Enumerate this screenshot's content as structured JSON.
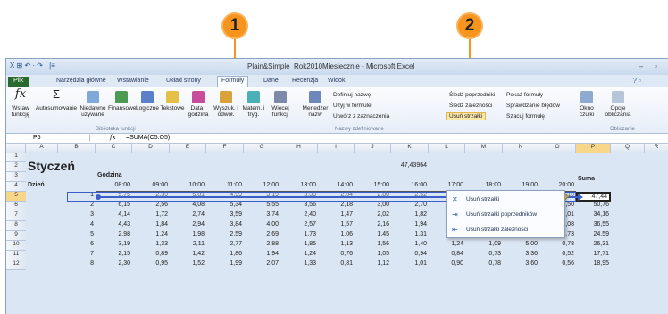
{
  "callouts": [
    "1",
    "2"
  ],
  "window": {
    "title": "Plain&Simple_Rok2010Miesiecznie - Microsoft Excel",
    "qat": "X ⊞ ↶ · ↷ · |≡"
  },
  "tabs": [
    "Plik",
    "Narzędzia główne",
    "Wstawianie",
    "Układ strony",
    "Formuły",
    "Dane",
    "Recenzja",
    "Widok"
  ],
  "ribbon": {
    "insert_function": "Wstaw funkcję",
    "autosum": "Autosumowanie",
    "recent": "Niedawno używane",
    "financial": "Finansowe",
    "logical": "Logiczne",
    "text": "Tekstowe",
    "datetime": "Data i godzina",
    "lookup": "Wyszuk. i odwoł.",
    "math": "Matem. i tryg.",
    "more": "Więcej funkcji",
    "library_group": "Biblioteka funkcji",
    "name_manager": "Menedżer nazw",
    "define_name": "Definiuj nazwę",
    "use_in_formula": "Użyj w formule",
    "create_from_selection": "Utwórz z zaznaczenia",
    "names_group": "Nazwy zdefiniowane",
    "trace_precedents": "Śledź poprzedniki",
    "trace_dependents": "Śledź zależności",
    "remove_arrows": "Usuń strzałki",
    "show_formulas": "Pokaż formuły",
    "error_checking": "Sprawdzanie błędów",
    "evaluate_formula": "Szacuj formułę",
    "watch_window": "Okno czujki",
    "calc_options": "Opcje obliczania",
    "calc_group": "Obliczanie"
  },
  "formula_bar": {
    "cell": "P5",
    "fx": "fx",
    "formula": "=SUMA(C5:O5)"
  },
  "dropdown": [
    "Usuń strzałki",
    "Usuń strzałki poprzedników",
    "Usuń strzałki zależności"
  ],
  "columns": [
    "A",
    "B",
    "C",
    "D",
    "E",
    "F",
    "G",
    "H",
    "I",
    "J",
    "K",
    "L",
    "M",
    "N",
    "O",
    "P",
    "Q",
    "R"
  ],
  "row_numbers": [
    "1",
    "2",
    "3",
    "4",
    "5",
    "6",
    "7",
    "8",
    "9",
    "10",
    "11",
    "12"
  ],
  "sheet": {
    "title": "Styczeń",
    "k2": "47,43964",
    "godzina": "Godzina",
    "dzien": "Dzień",
    "suma": "Suma",
    "hours": [
      "08:00",
      "09:00",
      "10:00",
      "11:00",
      "12:00",
      "13:00",
      "14:00",
      "15:00",
      "16:00",
      "17:00",
      "18:00",
      "19:00",
      "20:00"
    ],
    "rows": [
      {
        "day": "1",
        "vals": [
          "5,75",
          "2,39",
          "5,81",
          "4,99",
          "3,19",
          "3,33",
          "2,04",
          "2,80",
          "2,52",
          "2,24",
          "1,90",
          "5,01",
          "0,10"
        ],
        "sum": "47,44"
      },
      {
        "day": "2",
        "vals": [
          "6,15",
          "2,56",
          "4,08",
          "5,34",
          "5,55",
          "3,56",
          "2,18",
          "3,00",
          "2,70",
          "2,40",
          "2,10",
          "9,64",
          "1,50"
        ],
        "sum": "50,76"
      },
      {
        "day": "3",
        "vals": [
          "4,14",
          "1,72",
          "2,74",
          "3,59",
          "3,74",
          "2,40",
          "1,47",
          "2,02",
          "1,82",
          "1,61",
          "1,41",
          "6,49",
          "1,01"
        ],
        "sum": "34,16"
      },
      {
        "day": "4",
        "vals": [
          "4,43",
          "1,84",
          "2,94",
          "3,84",
          "4,00",
          "2,57",
          "1,57",
          "2,16",
          "1,94",
          "1,73",
          "1,51",
          "6,94",
          "1,08"
        ],
        "sum": "36,55"
      },
      {
        "day": "5",
        "vals": [
          "2,98",
          "1,24",
          "1,98",
          "2,59",
          "2,69",
          "1,73",
          "1,06",
          "1,45",
          "1,31",
          "1,16",
          "1,02",
          "4,67",
          "0,73"
        ],
        "sum": "24,59"
      },
      {
        "day": "6",
        "vals": [
          "3,19",
          "1,33",
          "2,11",
          "2,77",
          "2,88",
          "1,85",
          "1,13",
          "1,56",
          "1,40",
          "1,24",
          "1,09",
          "5,00",
          "0,78"
        ],
        "sum": "26,31"
      },
      {
        "day": "7",
        "vals": [
          "2,15",
          "0,89",
          "1,42",
          "1,86",
          "1,94",
          "1,24",
          "0,76",
          "1,05",
          "0,94",
          "0,84",
          "0,73",
          "3,36",
          "0,52"
        ],
        "sum": "17,71"
      },
      {
        "day": "8",
        "vals": [
          "2,30",
          "0,95",
          "1,52",
          "1,99",
          "2,07",
          "1,33",
          "0,81",
          "1,12",
          "1,01",
          "0,90",
          "0,78",
          "3,60",
          "0,56"
        ],
        "sum": "18,95"
      }
    ]
  },
  "colors": {
    "accent": "#f7941d",
    "file_tab": "#2b6a2e",
    "selection": "#f8d78a",
    "arrow": "#3a5fc8"
  }
}
